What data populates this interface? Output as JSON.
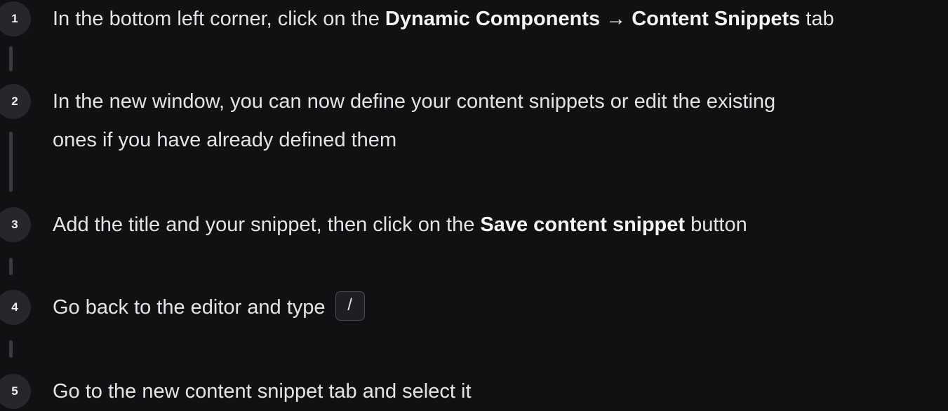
{
  "steps": [
    {
      "number": "1",
      "text_before": "In the bottom left corner, click on the ",
      "bold": "Dynamic Components → Content Snippets",
      "text_after": " tab"
    },
    {
      "number": "2",
      "line1": "In the new window, you can now define your content snippets or edit the existing",
      "line2": "ones if you have already defined them"
    },
    {
      "number": "3",
      "text_before": "Add the title and your snippet, then click on the ",
      "bold": "Save content snippet",
      "text_after": " button"
    },
    {
      "number": "4",
      "text_before": "Go back to the editor and type ",
      "key": "/"
    },
    {
      "number": "5",
      "text": "Go to the new content snippet tab and select it"
    }
  ]
}
